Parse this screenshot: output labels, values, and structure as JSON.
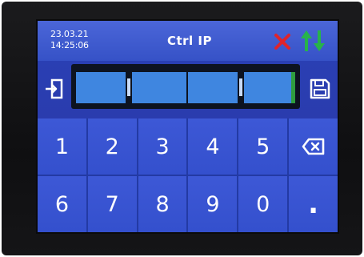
{
  "header": {
    "date": "23.03.21",
    "time": "14:25:06",
    "title": "Ctrl IP",
    "icons": {
      "close": "close-x-icon",
      "sync": "up-down-arrows-icon"
    },
    "colors": {
      "close": "#e0242b",
      "sync": "#27b34a"
    }
  },
  "ip_row": {
    "left_icon": "exit-icon",
    "right_icon": "save-floppy-icon",
    "fields": [
      "",
      "",
      "",
      ""
    ]
  },
  "keypad": {
    "keys": [
      "1",
      "2",
      "3",
      "4",
      "5",
      "⌫",
      "6",
      "7",
      "8",
      "9",
      "0",
      "."
    ]
  },
  "colors": {
    "screen_bg": "#1c2a8f",
    "header_bg": "#4b66d8",
    "key_bg": "#3d58d6",
    "field_bg": "#3f86e0",
    "active_field_accent": "#2f9e3f"
  }
}
